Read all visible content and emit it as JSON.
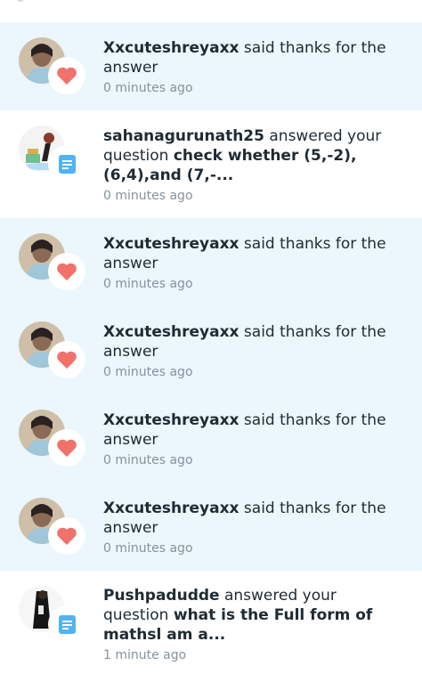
{
  "notifications": [
    {
      "user": "Xxcuteshreyaxx",
      "action": " said thanks for the answer",
      "time": "0 minutes ago",
      "type": "thanks",
      "unread": true
    },
    {
      "user": "sahanagurunath25",
      "action": " answered your question ",
      "question": "check whether (5,-2),(6,4),and (7,-...",
      "time": "0 minutes ago",
      "type": "answer",
      "unread": false
    },
    {
      "user": "Xxcuteshreyaxx",
      "action": " said thanks for the answer",
      "time": "0 minutes ago",
      "type": "thanks",
      "unread": true
    },
    {
      "user": "Xxcuteshreyaxx",
      "action": " said thanks for the answer",
      "time": "0 minutes ago",
      "type": "thanks",
      "unread": true
    },
    {
      "user": "Xxcuteshreyaxx",
      "action": " said thanks for the answer",
      "time": "0 minutes ago",
      "type": "thanks",
      "unread": true
    },
    {
      "user": "Xxcuteshreyaxx",
      "action": " said thanks for the answer",
      "time": "0 minutes ago",
      "type": "thanks",
      "unread": true
    },
    {
      "user": "Pushpadudde",
      "action": " answered your question ",
      "question": "what is the Full form of mathsl am a...",
      "time": "1 minute ago",
      "type": "answer",
      "unread": false
    }
  ],
  "icons": {
    "thanks": "heart-icon",
    "answer": "answer-document-icon"
  },
  "colors": {
    "unread_bg": "#ebf6fd",
    "heart": "#f1716b",
    "answer_badge": "#4fb3f6",
    "text": "#1f2a33",
    "time": "#86929b"
  }
}
